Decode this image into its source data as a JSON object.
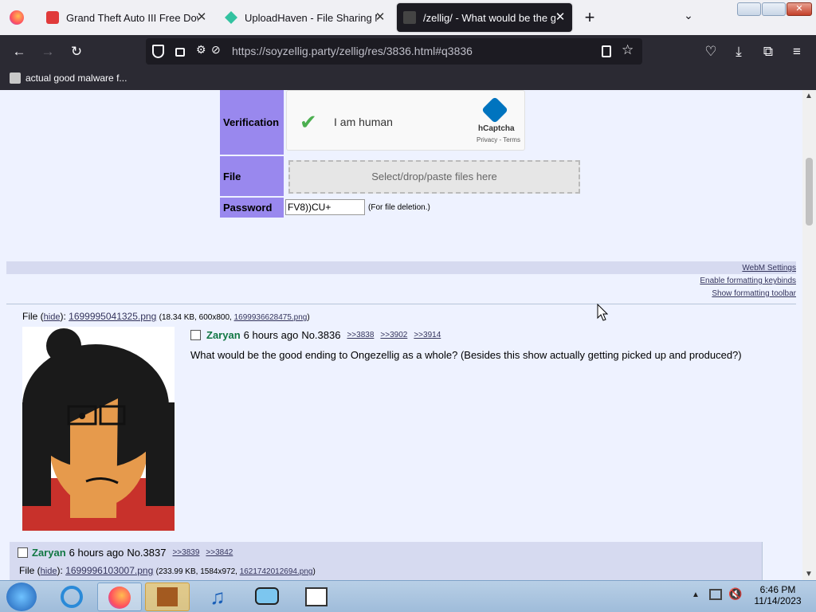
{
  "browser": {
    "tabs": [
      {
        "title": "Grand Theft Auto III Free Downl"
      },
      {
        "title": "UploadHaven - File Sharing Ma"
      },
      {
        "title": "/zellig/ - What would be the go"
      }
    ],
    "url": "https://soyzellig.party/zellig/res/3836.html#q3836",
    "bookmark": "actual good malware f..."
  },
  "form": {
    "verification_label": "Verification",
    "captcha_text": "I am human",
    "captcha_brand": "hCaptcha",
    "captcha_links": "Privacy - Terms",
    "file_label": "File",
    "dropzone_text": "Select/drop/paste files here",
    "password_label": "Password",
    "password_value": "FV8))CU+",
    "password_note": "(For file deletion.)"
  },
  "options": {
    "webm": "WebM Settings",
    "keybinds": "Enable formatting keybinds",
    "toolbar": "Show formatting toolbar"
  },
  "op": {
    "file_prefix": "File (",
    "hide": "hide",
    "file_mid": "): ",
    "filename": "1699995041325.png",
    "meta": "(18.34 KB, 600x800, ",
    "orig": "1699936628475.png",
    "meta_end": ")",
    "name": "Zaryan",
    "time": "6 hours ago",
    "no": "No.3836",
    "replies": [
      ">>3838",
      ">>3902",
      ">>3914"
    ],
    "body": "What would be the good ending to Ongezellig as a whole? (Besides this show actually getting picked up and produced?)"
  },
  "reply": {
    "name": "Zaryan",
    "time": "6 hours ago",
    "no": "No.3837",
    "replies": [
      ">>3839",
      ">>3842"
    ],
    "file_prefix": "File (",
    "hide": "hide",
    "file_mid": "): ",
    "filename": "1699996103007.png",
    "meta": "(233.99 KB, 1584x972, ",
    "orig": "1621742012694.png",
    "meta_end": ")"
  },
  "taskbar": {
    "time": "6:46 PM",
    "date": "11/14/2023"
  },
  "colors": {
    "form_label_bg": "#9988ee",
    "post_name": "#117743",
    "reply_bg": "#d6daf0"
  }
}
